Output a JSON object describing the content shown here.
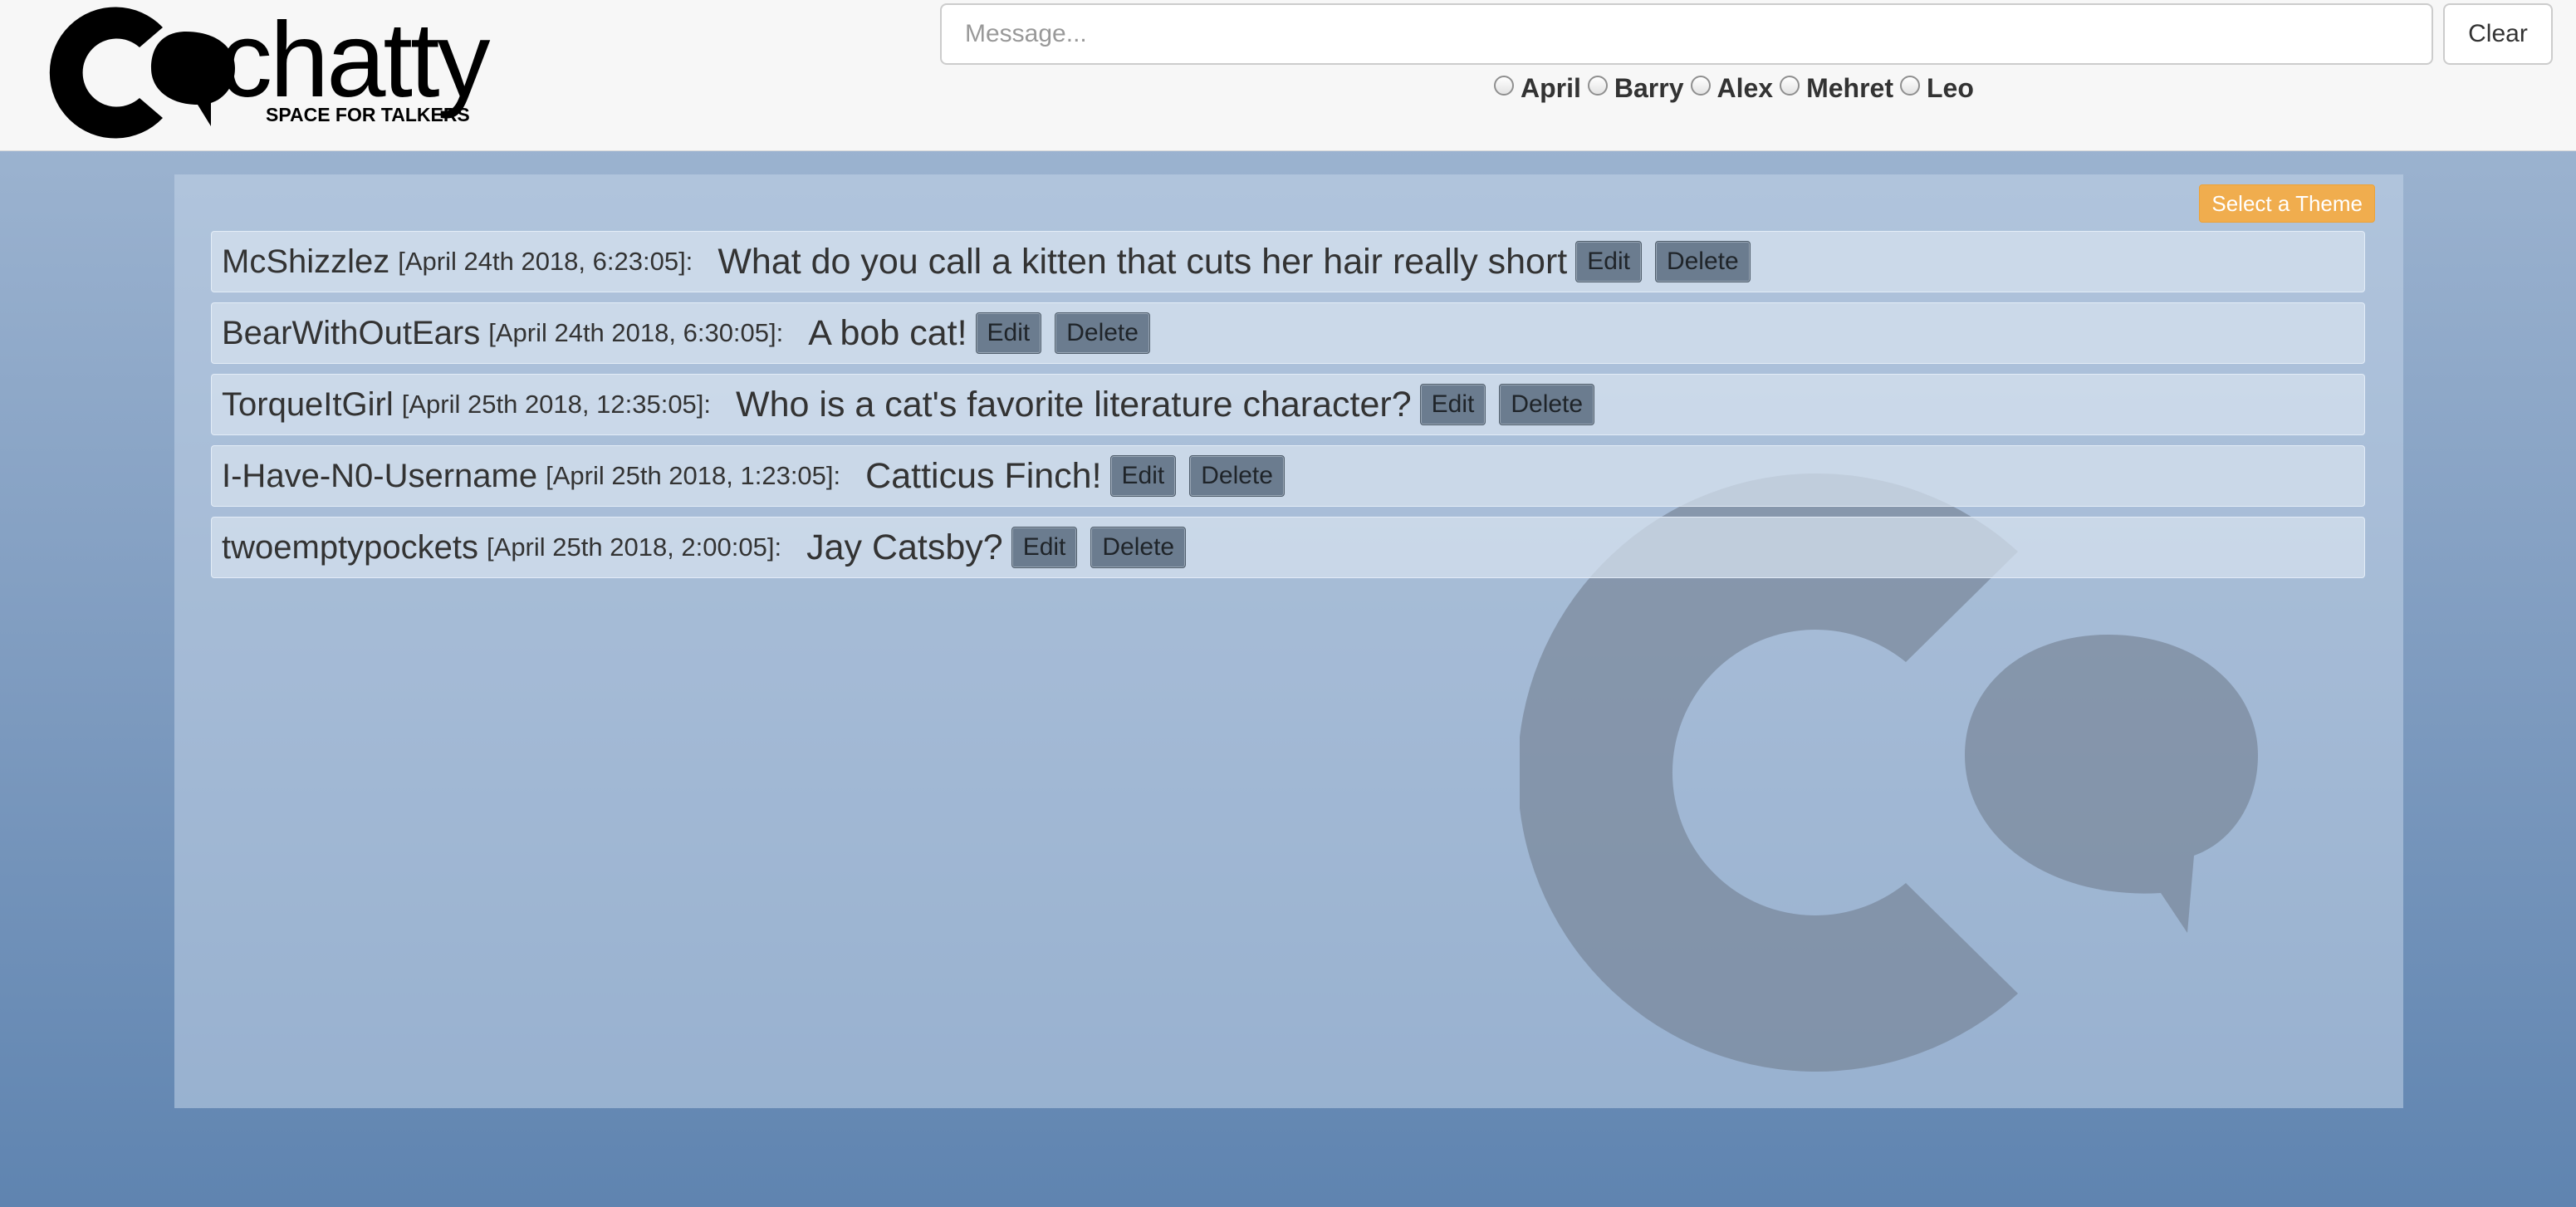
{
  "header": {
    "logo": {
      "name": "chatty",
      "tagline": "SPACE FOR TALKERS"
    },
    "message_input": {
      "placeholder": "Message...",
      "value": ""
    },
    "clear_label": "Clear",
    "users": [
      {
        "label": "April",
        "selected": false
      },
      {
        "label": "Barry",
        "selected": false
      },
      {
        "label": "Alex",
        "selected": false
      },
      {
        "label": "Mehret",
        "selected": false
      },
      {
        "label": "Leo",
        "selected": false
      }
    ]
  },
  "theme_button_label": "Select a Theme",
  "messages": [
    {
      "author": "McShizzlez",
      "timestamp": "[April 24th 2018, 6:23:05]:",
      "text": "What do you call a kitten that cuts her hair really short",
      "edit_label": "Edit",
      "delete_label": "Delete"
    },
    {
      "author": "BearWithOutEars",
      "timestamp": "[April 24th 2018, 6:30:05]:",
      "text": "A bob cat!",
      "edit_label": "Edit",
      "delete_label": "Delete"
    },
    {
      "author": "TorqueItGirl",
      "timestamp": "[April 25th 2018, 12:35:05]:",
      "text": "Who is a cat's favorite literature character?",
      "edit_label": "Edit",
      "delete_label": "Delete"
    },
    {
      "author": "I-Have-N0-Username",
      "timestamp": "[April 25th 2018, 1:23:05]:",
      "text": "Catticus Finch!",
      "edit_label": "Edit",
      "delete_label": "Delete"
    },
    {
      "author": "twoemptypockets",
      "timestamp": "[April 25th 2018, 2:00:05]:",
      "text": "Jay Catsby?",
      "edit_label": "Edit",
      "delete_label": "Delete"
    }
  ],
  "icons": [
    "chatty-logo-icon",
    "chatty-watermark-icon"
  ],
  "colors": {
    "header_background": "#f7f7f7",
    "page_background_top": "#a3b9d4",
    "page_background_bottom": "#5f84b0",
    "theme_button": "#f0ad4e",
    "row_button": "#6b7c8f",
    "text": "#333333"
  }
}
